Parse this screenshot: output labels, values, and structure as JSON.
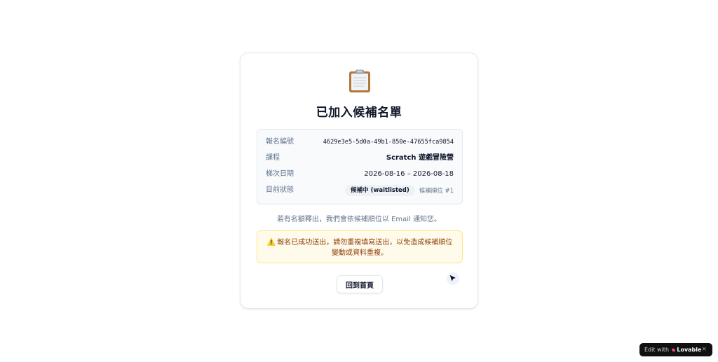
{
  "card": {
    "icon": "clipboard-icon",
    "title": "已加入候補名單",
    "info": {
      "registration_id_label": "報名編號",
      "registration_id_value": "4629e3e5-5d0a-49b1-850e-47655fca9854",
      "course_label": "課程",
      "course_value": "Scratch 遊戲冒險營",
      "session_label": "梯次日期",
      "session_value": "2026-08-16 – 2026-08-18",
      "status_label": "目前狀態",
      "status_badge": "候補中 (waitlisted)",
      "waitlist_rank": "候補順位 #1"
    },
    "notice": "若有名額釋出，我們會依候補順位以 Email 通知您。",
    "warning": {
      "icon": "warning-icon",
      "text": "報名已成功送出，請勿重複填寫送出，以免造成候補順位變動或資料重複。"
    },
    "home_button": "回到首頁"
  },
  "badge": {
    "edit_label": "Edit with",
    "brand": "Lovable",
    "close": "×"
  },
  "colors": {
    "warning_bg": "#fffbeb",
    "warning_border": "#fde68a",
    "warning_text": "#92400e",
    "lovable_gradient": [
      "#ff8a3d",
      "#ff3d8a",
      "#8a5cff"
    ]
  }
}
